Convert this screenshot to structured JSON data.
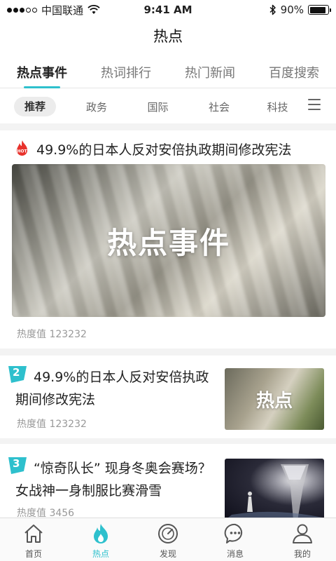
{
  "status_bar": {
    "carrier": "中国联通",
    "time": "9:41 AM",
    "battery_text": "90%",
    "battery_level": 0.9,
    "signal_strength": 3,
    "signal_max": 5
  },
  "nav": {
    "title": "热点"
  },
  "tabs": [
    {
      "label": "热点事件",
      "active": true
    },
    {
      "label": "热词排行",
      "active": false
    },
    {
      "label": "热门新闻",
      "active": false
    },
    {
      "label": "百度搜索",
      "active": false
    }
  ],
  "categories": [
    {
      "label": "推荐",
      "active": true
    },
    {
      "label": "政务",
      "active": false
    },
    {
      "label": "国际",
      "active": false
    },
    {
      "label": "社会",
      "active": false
    },
    {
      "label": "科技",
      "active": false
    }
  ],
  "feed": {
    "featured": {
      "badge": "HOT",
      "title": "49.9%的日本人反对安倍执政期间修改宪法",
      "image_caption": "热点事件",
      "heat": "热度值 123232"
    },
    "items": [
      {
        "rank": "2",
        "title": "49.9%的日本人反对安倍执政期间修改宪法",
        "heat": "热度值 123232",
        "thumb_caption": "热点"
      },
      {
        "rank": "3",
        "title": "“惊奇队长” 现身冬奥会赛场？女战神一身制服比赛滑雪",
        "heat": "热度值 3456",
        "thumb_caption": ""
      }
    ]
  },
  "bottom_nav": [
    {
      "label": "首页",
      "icon": "home-icon",
      "active": false
    },
    {
      "label": "热点",
      "icon": "flame-icon",
      "active": true
    },
    {
      "label": "发现",
      "icon": "compass-icon",
      "active": false
    },
    {
      "label": "消息",
      "icon": "message-icon",
      "active": false
    },
    {
      "label": "我的",
      "icon": "user-icon",
      "active": false
    }
  ],
  "colors": {
    "accent": "#2ec0cd",
    "hot_red": "#e8322c"
  }
}
